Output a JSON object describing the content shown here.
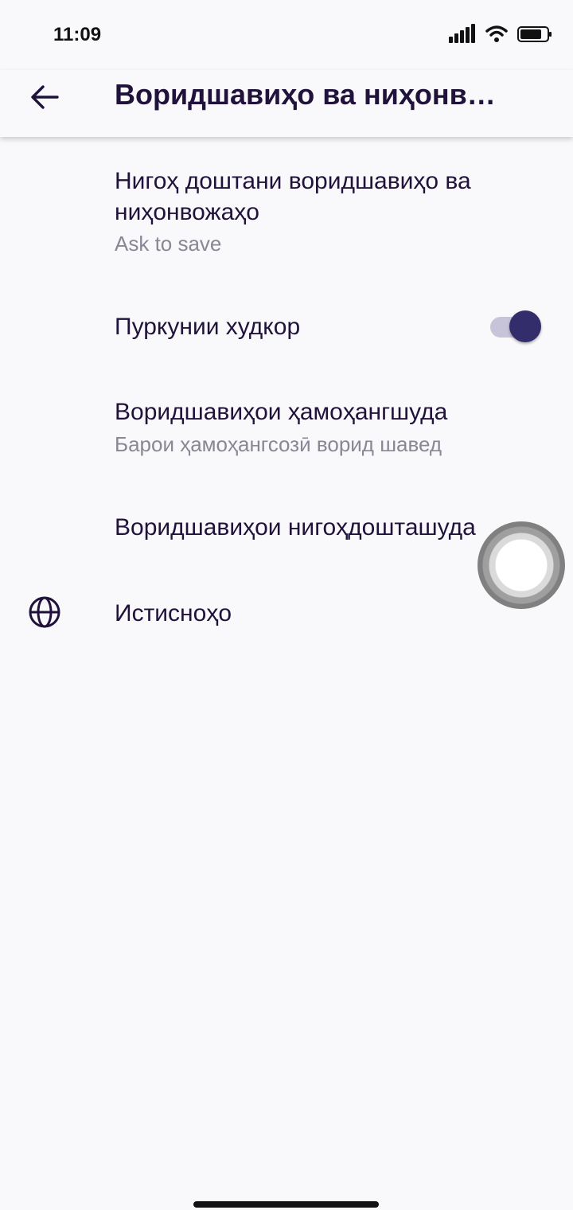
{
  "status_bar": {
    "time": "11:09"
  },
  "toolbar": {
    "title": "Воридшавиҳо ва ниҳонв…"
  },
  "preferences": {
    "save_logins": {
      "title": "Нигоҳ доштани воридшавиҳо ва ниҳонвожаҳо",
      "summary": "Ask to save"
    },
    "autofill": {
      "title": "Пуркунии худкор",
      "enabled": true
    },
    "synced_logins": {
      "title": "Воридшавиҳои ҳамоҳангшуда",
      "summary": "Барои ҳамоҳангсозӣ ворид шавед"
    },
    "saved_logins": {
      "title": "Воридшавиҳои нигоҳдошташуда"
    },
    "exceptions": {
      "title": "Истисноҳо"
    }
  },
  "colors": {
    "accent": "#332e6b",
    "text_primary": "#20123a",
    "text_secondary": "#8a8694",
    "background": "#f9f9fb"
  }
}
